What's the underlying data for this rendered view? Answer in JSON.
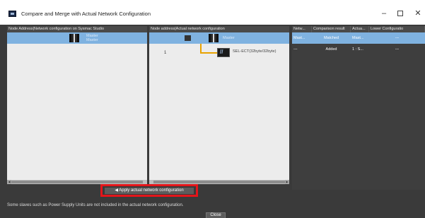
{
  "window": {
    "title": "Compare and Merge with Actual Network Configuration",
    "minimize_icon": "minimize-icon",
    "maximize_icon": "maximize-icon",
    "close_icon": "close-icon"
  },
  "left_pane": {
    "header": "Node Address|Network configuration on Sysmac Studio",
    "master_label": "Master\nMaster"
  },
  "mid_pane": {
    "header": "Node address|Actual network configuration",
    "master_label": "Master",
    "slave": {
      "node": "1",
      "name": "SEL-ECT(32byte/32byte)"
    }
  },
  "comparison_table": {
    "columns": [
      "Netw...",
      "Comparison result",
      "Actua...",
      "Lower Configuratio"
    ],
    "rows": [
      [
        "Mast...",
        "Matched",
        "Mast...",
        "---"
      ],
      [
        "---",
        "Added",
        "1 : S...",
        "---"
      ]
    ]
  },
  "actions": {
    "apply_label": "◀ Apply actual network configuration",
    "close_label": "Close"
  },
  "info": "Some slaves such as Power Supply Units are not included in the actual network configuration.",
  "colors": {
    "selection": "#7fb2e0",
    "highlight_border": "#e4151a",
    "dialog_bg": "#3a3a3a"
  }
}
